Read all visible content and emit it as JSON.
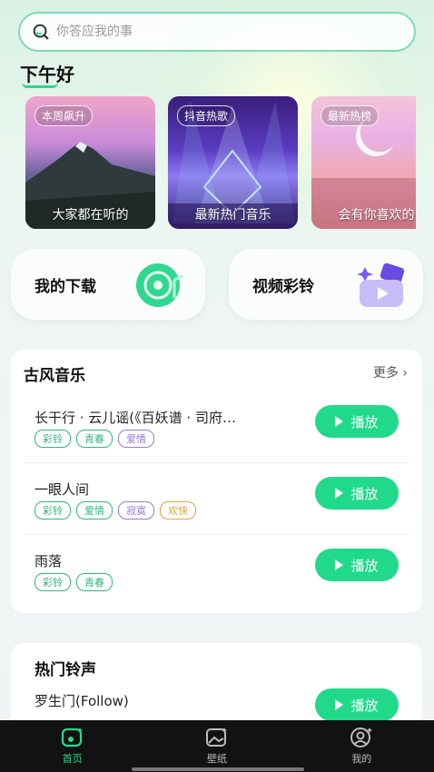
{
  "search": {
    "placeholder": "你答应我的事"
  },
  "greeting": "下午好",
  "featured": [
    {
      "tag": "本周飙升",
      "caption": "大家都在听的"
    },
    {
      "tag": "抖音热歌",
      "caption": "最新热门音乐"
    },
    {
      "tag": "最新热榜",
      "caption": "会有你喜欢的"
    }
  ],
  "quick": {
    "download": "我的下载",
    "video_ringtone": "视频彩铃"
  },
  "gufeng": {
    "title": "古风音乐",
    "more": "更多",
    "songs": [
      {
        "name": "长干行 · 云儿谣(《百妖谱 · 司府…",
        "tags": [
          "彩铃",
          "青春",
          "爱情"
        ],
        "play": "播放"
      },
      {
        "name": "一眼人间",
        "tags": [
          "彩铃",
          "爱情",
          "寂寞",
          "欢快"
        ],
        "play": "播放"
      },
      {
        "name": "雨落",
        "tags": [
          "彩铃",
          "青春"
        ],
        "play": "播放"
      }
    ]
  },
  "hot": {
    "title": "热门铃声",
    "songs": [
      {
        "name": "罗生门(Follow)",
        "play": "播放"
      }
    ]
  },
  "tabs": [
    {
      "label": "首页",
      "icon": "home-icon",
      "active": true
    },
    {
      "label": "壁纸",
      "icon": "wallpaper-icon",
      "active": false
    },
    {
      "label": "我的",
      "icon": "profile-icon",
      "active": false
    }
  ],
  "colors": {
    "accent": "#21d98a",
    "tabbar": "#121212"
  }
}
